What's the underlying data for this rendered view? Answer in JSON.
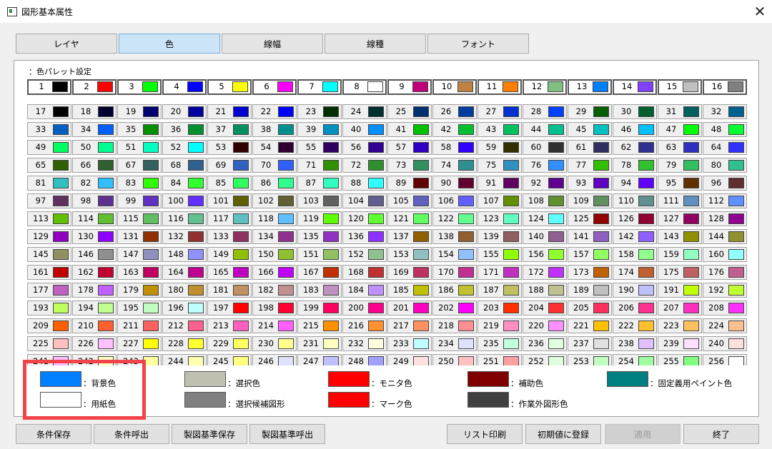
{
  "window": {
    "title": "図形基本属性"
  },
  "tabs": [
    "レイヤ",
    "色",
    "線幅",
    "線種",
    "フォント"
  ],
  "palette": {
    "title": "：色パレット設定",
    "colors": [
      "#000000",
      "#ff0000",
      "#00ff00",
      "#0000ff",
      "#ffff00",
      "#ff00ff",
      "#00ffff",
      "#ffffff",
      "#c0007a",
      "#c08040",
      "#ff7f00",
      "#80c080",
      "#0080ff",
      "#8040ff",
      "#c0c0c0",
      "#808080",
      "#000000",
      "#000030",
      "#000070",
      "#0000a0",
      "#0000d0",
      "#0000ff",
      "#003000",
      "#002f2f",
      "#003070",
      "#003ca0",
      "#0030d0",
      "#0040ff",
      "#006000",
      "#006030",
      "#006060",
      "#006090",
      "#0060c0",
      "#0060ff",
      "#009000",
      "#009030",
      "#009060",
      "#009090",
      "#0090c0",
      "#0090ff",
      "#00c000",
      "#00c030",
      "#00c060",
      "#00c090",
      "#00c0c0",
      "#00c0ff",
      "#00ff00",
      "#00ff30",
      "#00ff60",
      "#00ff90",
      "#00ffc0",
      "#00ffff",
      "#300000",
      "#300030",
      "#300060",
      "#300090",
      "#3000c0",
      "#3000ff",
      "#303000",
      "#303030",
      "#303060",
      "#303090",
      "#3030c0",
      "#3030ff",
      "#306000",
      "#306030",
      "#306060",
      "#306090",
      "#3060c0",
      "#3060ff",
      "#309000",
      "#309030",
      "#309060",
      "#309090",
      "#3090c0",
      "#3090ff",
      "#30c000",
      "#30c030",
      "#30c060",
      "#30c090",
      "#30c0c0",
      "#30c0ff",
      "#30ff00",
      "#30ff30",
      "#30ff60",
      "#30ff90",
      "#30ffc0",
      "#30ffff",
      "#600000",
      "#600030",
      "#600060",
      "#600090",
      "#6000c0",
      "#6000ff",
      "#603000",
      "#603030",
      "#603060",
      "#603090",
      "#6030c0",
      "#6030ff",
      "#606000",
      "#606030",
      "#606060",
      "#606090",
      "#6060c0",
      "#6060ff",
      "#609000",
      "#609030",
      "#609060",
      "#609090",
      "#6090c0",
      "#6090ff",
      "#60c000",
      "#60c030",
      "#60c060",
      "#60c090",
      "#60c0c0",
      "#60c0ff",
      "#60ff00",
      "#60ff30",
      "#60ff60",
      "#60ff90",
      "#60ffc0",
      "#60ffff",
      "#900000",
      "#900030",
      "#900060",
      "#900090",
      "#9000c0",
      "#9000ff",
      "#903000",
      "#903030",
      "#903060",
      "#903090",
      "#9030c0",
      "#9030ff",
      "#906000",
      "#906030",
      "#906060",
      "#906090",
      "#9060c0",
      "#9060ff",
      "#909000",
      "#909030",
      "#909060",
      "#909090",
      "#9090c0",
      "#9090ff",
      "#90c000",
      "#90c030",
      "#90c060",
      "#90c090",
      "#90c0c0",
      "#90c0ff",
      "#90ff00",
      "#90ff30",
      "#90ff60",
      "#90ff90",
      "#90ffc0",
      "#90ffff",
      "#c00000",
      "#c00030",
      "#c00060",
      "#c00090",
      "#c000c0",
      "#c000ff",
      "#c03000",
      "#c03030",
      "#c03060",
      "#c03090",
      "#c030c0",
      "#c030ff",
      "#c06000",
      "#c06030",
      "#c06060",
      "#c06090",
      "#c060c0",
      "#c060ff",
      "#c09000",
      "#c09030",
      "#c09060",
      "#c09090",
      "#c090c0",
      "#c090ff",
      "#c0c000",
      "#c0c030",
      "#c0c060",
      "#c0c090",
      "#c0c0c0",
      "#c0c0ff",
      "#c0ff00",
      "#c0ff30",
      "#c0ff60",
      "#c0ff90",
      "#c0ffc0",
      "#c0ffff",
      "#ff0000",
      "#ff0030",
      "#ff0060",
      "#ff0090",
      "#ff00c0",
      "#ff00ff",
      "#ff3000",
      "#ff3030",
      "#ff3060",
      "#ff3090",
      "#ff30c0",
      "#ff30ff",
      "#ff6000",
      "#ff6030",
      "#ff6060",
      "#ff6090",
      "#ff60c0",
      "#ff60ff",
      "#ff9000",
      "#ff9030",
      "#ff9060",
      "#ff9090",
      "#ff90c0",
      "#ff90ff",
      "#ffc000",
      "#ffc030",
      "#ffc060",
      "#ffc090",
      "#ffc0c0",
      "#ffc0ff",
      "#ffff00",
      "#ffff30",
      "#ffff60",
      "#ffff90",
      "#ffffc0",
      "#ffffe0",
      "#c0ffff",
      "#e0e0ff",
      "#c0ffe0",
      "#e0ffe0",
      "#e0e0e0",
      "#e0c0ff",
      "#ffe0ff",
      "#ffe0e0",
      "#ffc0ff",
      "#ffffc0",
      "#ffffa0",
      "#ffffb0",
      "#ffff80",
      "#e0e0ff",
      "#c0c0ff",
      "#a0a0ff",
      "#ffe0e0",
      "#ffc0c0",
      "#ffa0a0",
      "#e0ffe0",
      "#c0ffc0",
      "#a0ffa0",
      "#80ff80",
      "#ffffff"
    ]
  },
  "legend": [
    {
      "label": "：背景色",
      "color": "#0080ff"
    },
    {
      "label": "：用紙色",
      "color": "#ffffff"
    },
    {
      "label": "：選択色",
      "color": "#c0c0b0"
    },
    {
      "label": "：選択候補図形",
      "color": "#808080"
    },
    {
      "label": "：モニタ色",
      "color": "#ff0000"
    },
    {
      "label": "：マーク色",
      "color": "#ff0000"
    },
    {
      "label": "：補助色",
      "color": "#800000"
    },
    {
      "label": "：作業外図形色",
      "color": "#404040"
    },
    {
      "label": "：固定義用ペイント色",
      "color": "#008080"
    }
  ],
  "buttons": [
    "条件保存",
    "条件呼出",
    "製図基準保存",
    "製図基準呼出",
    "リスト印刷",
    "初期値に登録",
    "適用",
    "終了"
  ],
  "icons": {
    "app": "app-icon",
    "close": "close-icon",
    "cursor": "mouse-cursor-icon"
  }
}
